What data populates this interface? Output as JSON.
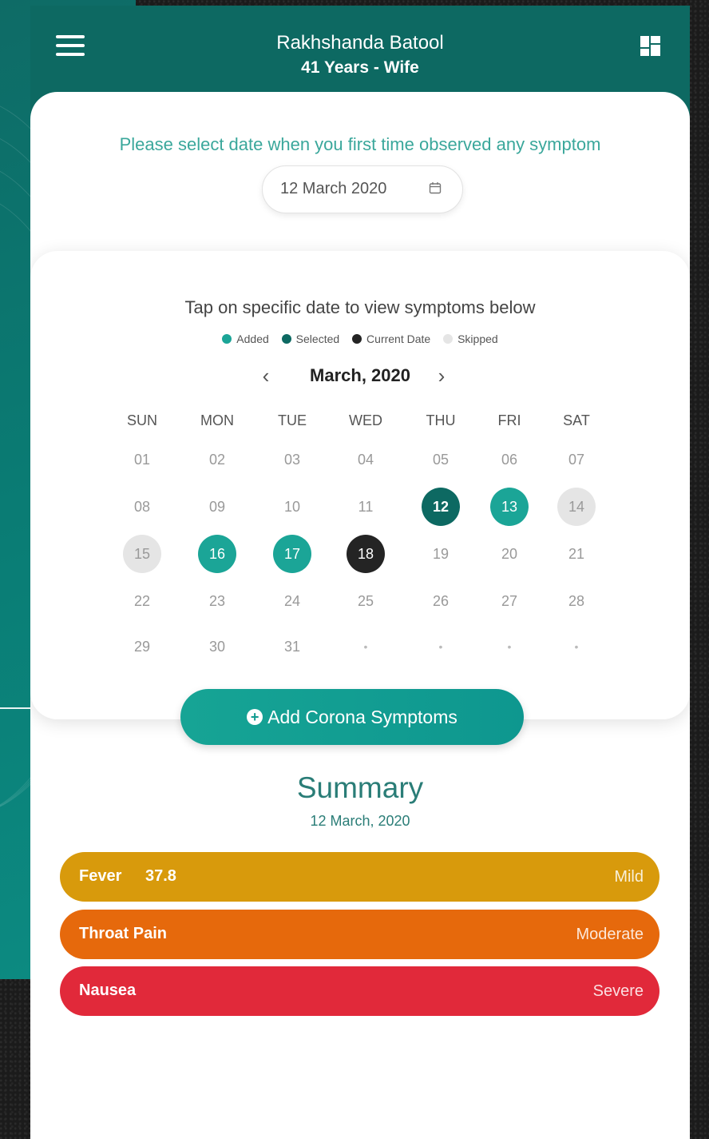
{
  "header": {
    "name": "Rakhshanda Batool",
    "subtitle": "41 Years - Wife"
  },
  "date_prompt": "Please select date when you first time observed any symptom",
  "date_field": {
    "value": "12 March 2020"
  },
  "calendar": {
    "instruction": "Tap on specific date to view symptoms below",
    "legend": [
      {
        "label": "Added",
        "color": "#1ba597"
      },
      {
        "label": "Selected",
        "color": "#0d6962"
      },
      {
        "label": "Current Date",
        "color": "#242424"
      },
      {
        "label": "Skipped",
        "color": "#e5e5e5"
      }
    ],
    "month": "March, 2020",
    "prev_icon": "chevron-left-icon",
    "next_icon": "chevron-right-icon",
    "weekdays": [
      "SUN",
      "MON",
      "TUE",
      "WED",
      "THU",
      "FRI",
      "SAT"
    ],
    "weeks": [
      [
        "01",
        "02",
        "03",
        "04",
        "05",
        "06",
        "07"
      ],
      [
        "08",
        "09",
        "10",
        "11",
        "12",
        "13",
        "14"
      ],
      [
        "15",
        "16",
        "17",
        "18",
        "19",
        "20",
        "21"
      ],
      [
        "22",
        "23",
        "24",
        "25",
        "26",
        "27",
        "28"
      ],
      [
        "29",
        "30",
        "31",
        "•",
        "•",
        "•",
        "•"
      ]
    ],
    "states": {
      "12": "selected",
      "13": "added",
      "14": "skipped",
      "15": "skipped",
      "16": "added",
      "17": "added",
      "18": "current"
    }
  },
  "add_button": {
    "label": "Add Corona Symptoms",
    "icon": "plus-circle-icon"
  },
  "summary": {
    "title": "Summary",
    "date": "12 March, 2020",
    "items": [
      {
        "name": "Fever",
        "reading": "37.8",
        "severity": "Mild",
        "color": "#d89a0c"
      },
      {
        "name": "Throat Pain",
        "reading": "",
        "severity": "Moderate",
        "color": "#e6690c"
      },
      {
        "name": "Nausea",
        "reading": "",
        "severity": "Severe",
        "color": "#e1293a"
      }
    ]
  }
}
